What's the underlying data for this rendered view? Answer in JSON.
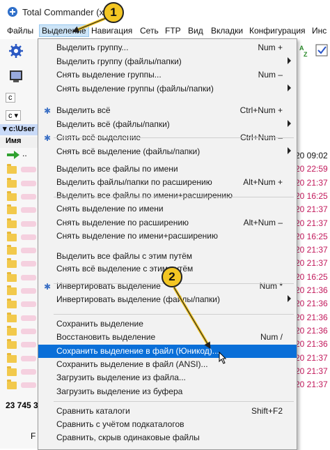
{
  "window": {
    "title": "Total Commander (x64)"
  },
  "menubar": {
    "items": [
      {
        "label": "Файлы"
      },
      {
        "label": "Выделение"
      },
      {
        "label": "Навигация"
      },
      {
        "label": "Сеть"
      },
      {
        "label": "FTP"
      },
      {
        "label": "Вид"
      },
      {
        "label": "Вкладки"
      },
      {
        "label": "Конфигурация"
      },
      {
        "label": "Инс"
      }
    ]
  },
  "panel": {
    "drive_label": "c",
    "drive_label_2": "c",
    "path": "c:\\User",
    "column_header": "Имя",
    "up_entry": "..",
    "status": "23 745 3",
    "bottom_left": "F"
  },
  "dates": [
    "20 09:02",
    "20 22:59",
    "20 21:37",
    "20 16:25",
    "20 21:37",
    "20 21:37",
    "20 16:25",
    "20 21:37",
    "20 21:37",
    "20 16:25",
    "20 21:36",
    "20 21:36",
    "20 21:36",
    "20 21:36",
    "20 21:36",
    "20 21:37",
    "20 21:37",
    "20 21:37"
  ],
  "dropdown": {
    "items": [
      {
        "label": "Выделить группу...",
        "shortcut": "Num +",
        "arrow": false,
        "icon": false
      },
      {
        "label": "Выделить группу (файлы/папки)",
        "shortcut": "",
        "arrow": true,
        "icon": false
      },
      {
        "label": "Снять выделение группы...",
        "shortcut": "Num –",
        "arrow": false,
        "icon": false
      },
      {
        "label": "Снять выделение группы (файлы/папки)",
        "shortcut": "",
        "arrow": true,
        "icon": false
      },
      {
        "label": "Выделить всё",
        "shortcut": "Ctrl+Num +",
        "arrow": false,
        "icon": true
      },
      {
        "label": "Выделить всё (файлы/папки)",
        "shortcut": "",
        "arrow": true,
        "icon": false
      },
      {
        "label": "Снять всё выделение",
        "shortcut": "Ctrl+Num –",
        "arrow": false,
        "icon": true
      },
      {
        "label": "Снять всё выделение (файлы/папки)",
        "shortcut": "",
        "arrow": true,
        "icon": false
      },
      {
        "label": "Выделить все файлы по имени",
        "shortcut": "",
        "arrow": false,
        "icon": false
      },
      {
        "label": "Выделить файлы/папки по расширению",
        "shortcut": "Alt+Num +",
        "arrow": false,
        "icon": false
      },
      {
        "label": "Выделить все файлы по имени+расширению",
        "shortcut": "",
        "arrow": false,
        "icon": false
      },
      {
        "label": "Снять выделение по имени",
        "shortcut": "",
        "arrow": false,
        "icon": false
      },
      {
        "label": "Снять выделение по расширению",
        "shortcut": "Alt+Num –",
        "arrow": false,
        "icon": false
      },
      {
        "label": "Снять выделение по имени+расширению",
        "shortcut": "",
        "arrow": false,
        "icon": false
      },
      {
        "label": "Выделить все файлы с этим путём",
        "shortcut": "",
        "arrow": false,
        "icon": false
      },
      {
        "label": "Снять всё выделение с этим путём",
        "shortcut": "",
        "arrow": false,
        "icon": false
      },
      {
        "label": "Инвертировать выделение",
        "shortcut": "Num *",
        "arrow": false,
        "icon": true
      },
      {
        "label": "Инвертировать выделение (файлы/папки)",
        "shortcut": "",
        "arrow": true,
        "icon": false
      },
      {
        "label": "Сохранить выделение",
        "shortcut": "",
        "arrow": false,
        "icon": false
      },
      {
        "label": "Восстановить выделение",
        "shortcut": "Num /",
        "arrow": false,
        "icon": false
      },
      {
        "label": "Сохранить выделение в файл (Юникод)...",
        "shortcut": "",
        "arrow": false,
        "icon": false
      },
      {
        "label": "Сохранить выделение в файл (ANSI)...",
        "shortcut": "",
        "arrow": false,
        "icon": false
      },
      {
        "label": "Загрузить выделение из файла...",
        "shortcut": "",
        "arrow": false,
        "icon": false
      },
      {
        "label": "Загрузить выделение из буфера",
        "shortcut": "",
        "arrow": false,
        "icon": false
      },
      {
        "label": "Сравнить каталоги",
        "shortcut": "Shift+F2",
        "arrow": false,
        "icon": false
      },
      {
        "label": "Сравнить с учётом подкаталогов",
        "shortcut": "",
        "arrow": false,
        "icon": false
      },
      {
        "label": "Сравнить, скрыв одинаковые файлы",
        "shortcut": "",
        "arrow": false,
        "icon": false
      }
    ]
  },
  "badges": {
    "one": "1",
    "two": "2"
  },
  "colors": {
    "highlight": "#0a6fd8",
    "menu_active": "#cce4f7",
    "date_text": "#c2185b",
    "badge": "#f3c623"
  }
}
